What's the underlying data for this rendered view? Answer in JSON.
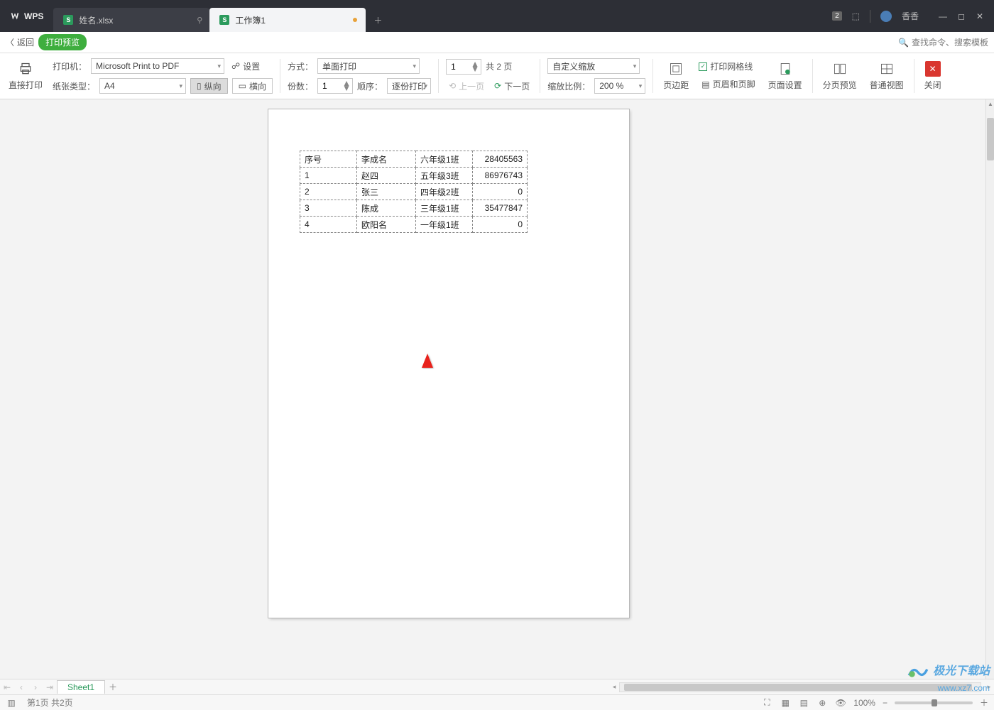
{
  "app": {
    "name": "WPS"
  },
  "tabs": [
    {
      "label": "姓名.xlsx",
      "active": false,
      "hint": "pin"
    },
    {
      "label": "工作簿1",
      "active": true,
      "hint": "dot"
    }
  ],
  "titleRight": {
    "badge": "2",
    "user": "香香"
  },
  "backrow": {
    "back": "返回",
    "pill": "打印预览",
    "search": "查找命令、搜索模板"
  },
  "ribbon": {
    "directPrint": "直接打印",
    "printerLabel": "打印机：",
    "printerValue": "Microsoft Print to PDF",
    "settings": "设置",
    "paperLabel": "纸张类型：",
    "paperValue": "A4",
    "portrait": "纵向",
    "landscape": "横向",
    "modeLabel": "方式：",
    "modeValue": "单面打印",
    "copiesLabel": "份数：",
    "copiesValue": "1",
    "orderLabel": "顺序：",
    "orderValue": "逐份打印",
    "pageValue": "1",
    "pageTotal": "共 2 页",
    "prev": "上一页",
    "next": "下一页",
    "zoomMode": "自定义缩放",
    "zoomRatioLabel": "缩放比例：",
    "zoomRatioValue": "200 %",
    "margins": "页边距",
    "gridlines": "打印网格线",
    "headerFooter": "页眉和页脚",
    "pageSetup": "页面设置",
    "pageBreakPreview": "分页预览",
    "normalView": "普通视图",
    "close": "关闭"
  },
  "table": {
    "rows": [
      [
        "序号",
        "李成名",
        "六年级1班",
        "28405563"
      ],
      [
        "1",
        "赵四",
        "五年级3班",
        "86976743"
      ],
      [
        "2",
        "张三",
        "四年级2班",
        "0"
      ],
      [
        "3",
        "陈成",
        "三年级1班",
        "35477847"
      ],
      [
        "4",
        "欧阳名",
        "一年级1班",
        "0"
      ]
    ]
  },
  "sheet": {
    "name": "Sheet1"
  },
  "status": {
    "pageInfo": "第1页 共2页",
    "zoom": "100%"
  },
  "watermark": {
    "line1": "极光下载站",
    "line2": "www.xz7.com"
  }
}
